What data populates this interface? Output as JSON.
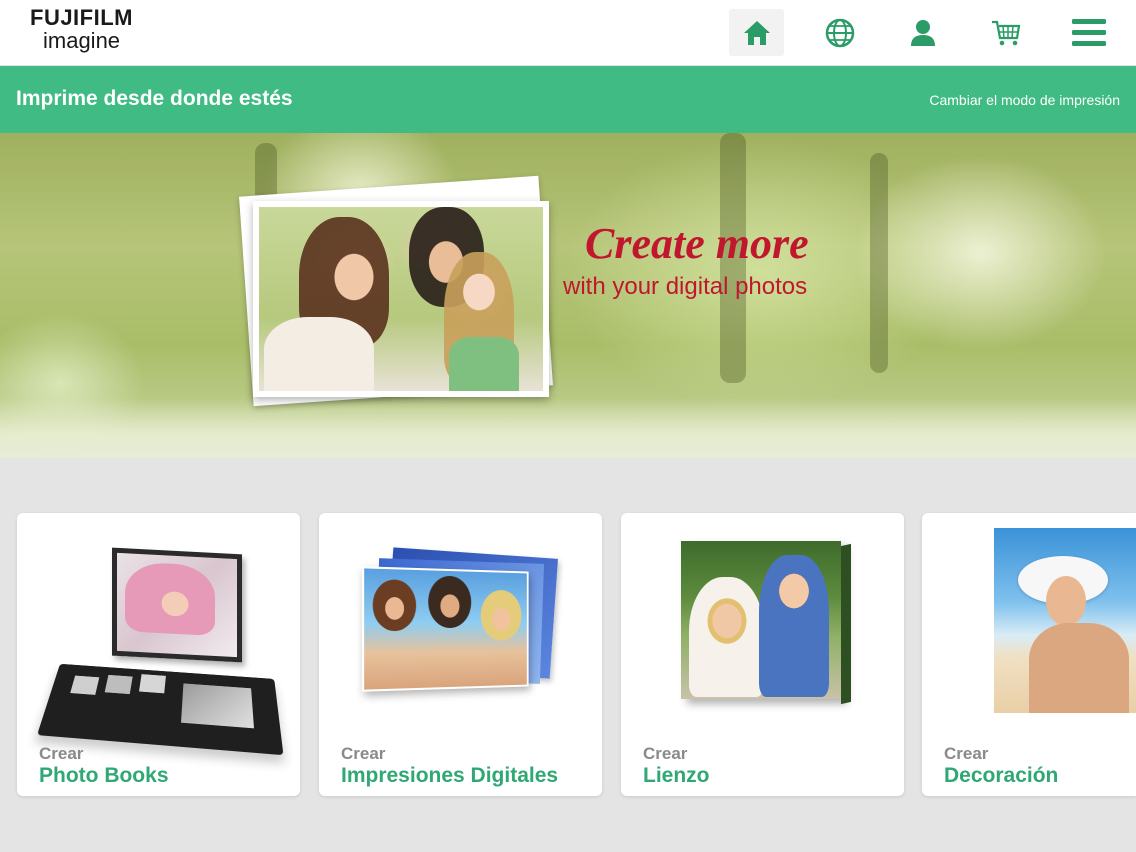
{
  "header": {
    "logo_brand": "FUJIFILM",
    "logo_sub": "imagine",
    "nav": [
      {
        "name": "home",
        "icon": "home-icon",
        "active": true
      },
      {
        "name": "globe",
        "icon": "globe-icon",
        "active": false
      },
      {
        "name": "account",
        "icon": "user-icon",
        "active": false
      },
      {
        "name": "cart",
        "icon": "cart-icon",
        "active": false
      },
      {
        "name": "menu",
        "icon": "menu-icon",
        "active": false
      }
    ]
  },
  "banner": {
    "title": "Imprime desde donde estés",
    "link": "Cambiar el modo de impresión"
  },
  "hero": {
    "title": "Create more",
    "subtitle": "with your digital photos"
  },
  "cards": [
    {
      "prefix": "Crear",
      "title": "Photo Books"
    },
    {
      "prefix": "Crear",
      "title": "Impresiones Digitales"
    },
    {
      "prefix": "Crear",
      "title": "Lienzo"
    },
    {
      "prefix": "Crear",
      "title": "Decoración"
    }
  ],
  "colors": {
    "accent_green": "#3fbb83",
    "title_green": "#2fa874",
    "hero_red": "#c0172f",
    "icon_green": "#2b9b67"
  }
}
